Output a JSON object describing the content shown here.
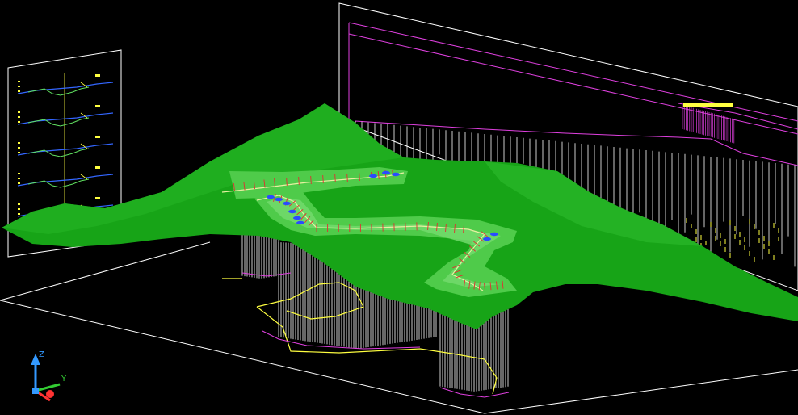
{
  "viewport": {
    "background": "#000000",
    "colors": {
      "terrain": "#18a018",
      "terrain_light": "#3fc23a",
      "road_band": "#5fd05a",
      "frame": "#ffffff",
      "profile_magenta": "#e040e0",
      "section_yellow": "#ffff40",
      "section_green": "#60e060",
      "alignment_red": "#e03030",
      "axis_blue": "#3399ff",
      "axis_green": "#33cc33",
      "axis_red": "#ff3333"
    }
  },
  "axes": {
    "z_label": "Z",
    "y_label": "Y",
    "icon": "ucs-axis-icon"
  },
  "cross_section_sheet": {
    "icon": "cross-section-sheet-icon",
    "section_labels": [
      "",
      "",
      "",
      "",
      ""
    ]
  },
  "profile_sheet": {
    "icon": "longitudinal-profile-icon"
  },
  "terrain": {
    "icon": "terrain-surface-icon"
  }
}
